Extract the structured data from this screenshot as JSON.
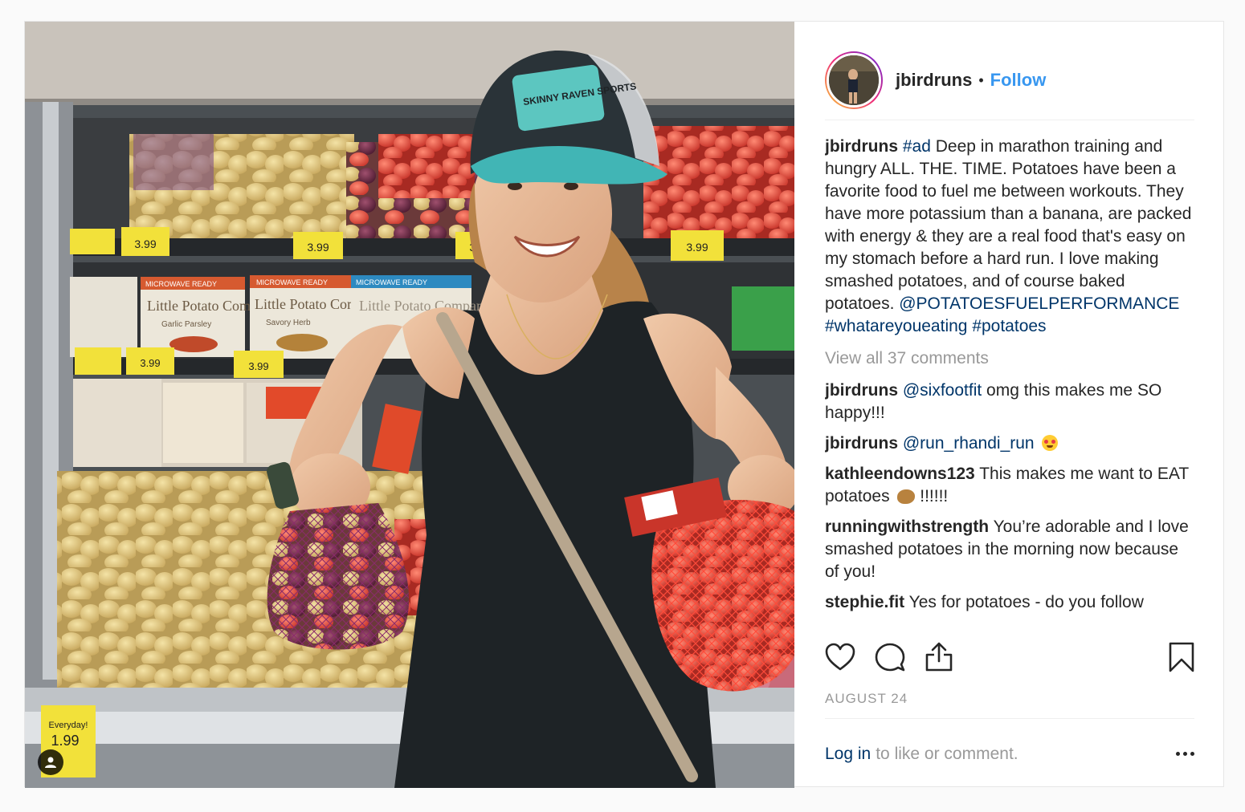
{
  "post": {
    "header": {
      "username": "jbirdruns",
      "separator": "•",
      "follow_label": "Follow"
    },
    "caption": {
      "username": "jbirdruns",
      "hashtag_ad": "#ad",
      "text": " Deep in marathon training and hungry ALL. THE. TIME. Potatoes have been a favorite food to fuel me between workouts. They have more potassium than a banana, are packed with energy & they are a real food that's easy on my stomach before a hard run. I love making smashed potatoes, and of course baked potatoes. ",
      "mention": "@POTATOESFUELPERFORMANCE",
      "hashtag1": "#whatareyoueating",
      "hashtag2": "#potatoes"
    },
    "view_all_comments": "View all 37 comments",
    "comments": [
      {
        "username": "jbirdruns",
        "mention": "@sixfootfit",
        "text": " omg this makes me SO happy!!!"
      },
      {
        "username": "jbirdruns",
        "mention": "@run_rhandi_run",
        "text": " "
      },
      {
        "username": "kathleendowns123",
        "text": " This makes me want to EAT potatoes ",
        "text_after": " !!!!!!"
      },
      {
        "username": "runningwithstrength",
        "text": " You’re adorable and I love smashed potatoes in the morning now because of you!"
      },
      {
        "username": "stephie.fit",
        "text": " Yes for potatoes - do you follow"
      }
    ],
    "date": "AUGUST 24",
    "footer": {
      "login_label": "Log in",
      "rest": "to like or comment."
    },
    "icons": {
      "like": "heart-icon",
      "comment": "comment-bubble-icon",
      "share": "share-icon",
      "save": "bookmark-icon",
      "more": "more-options-icon",
      "tag": "tagged-user-icon"
    },
    "colors": {
      "link": "#003569",
      "follow": "#3897f0",
      "muted": "#999999",
      "text": "#262626"
    },
    "photo_text": {
      "cap_logo": "SKINNY RAVEN SPORTS",
      "bag_brand_1": "Little Potato Company",
      "bag_label_1": "Garlic Parsley",
      "bag_label_2": "Savory Herb",
      "microwave": "MICROWAVE READY",
      "price": "3.99",
      "price_bottom": "1.99",
      "everyday": "Everyday!"
    }
  }
}
